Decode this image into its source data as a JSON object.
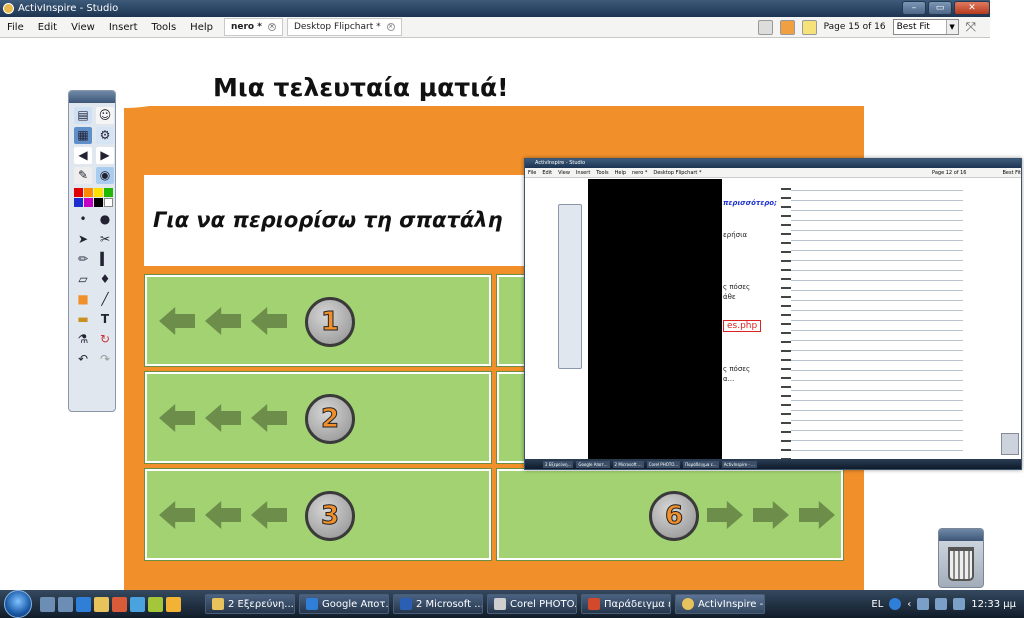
{
  "window": {
    "title": "ActivInspire - Studio"
  },
  "menu": {
    "items": [
      "File",
      "Edit",
      "View",
      "Insert",
      "Tools",
      "Help"
    ],
    "tabs": [
      {
        "label": "nero *",
        "active": true
      },
      {
        "label": "Desktop Flipchart *",
        "active": false
      }
    ],
    "page_indicator": "Page 15 of 16",
    "zoom": "Best Fit"
  },
  "flipchart": {
    "title": "Μια τελευταία ματιά!",
    "question": "Για να περιορίσω τη σπατάλη",
    "boxes": [
      {
        "number": "1",
        "arrow_direction": "left"
      },
      {
        "number": "2",
        "arrow_direction": "left"
      },
      {
        "number": "3",
        "arrow_direction": "left"
      },
      {
        "number": "6",
        "arrow_direction": "right"
      }
    ],
    "colors": {
      "orange": "#f18f2b",
      "green": "#a2d271",
      "arrow": "#6c8e4a"
    }
  },
  "inset": {
    "title": "ActivInspire - Studio",
    "menu_items": [
      "File",
      "Edit",
      "View",
      "Insert",
      "Tools",
      "Help"
    ],
    "tabs": [
      "nero *",
      "Desktop Flipchart *"
    ],
    "page_indicator": "Page 12 of 16",
    "zoom": "Best Fit",
    "notes": [
      {
        "text": "περισσότερο;",
        "style": "blue"
      },
      {
        "text": "ερήσια",
        "style": "plain"
      },
      {
        "text": "ς πόσες",
        "style": "plain"
      },
      {
        "text": "άθε",
        "style": "plain"
      },
      {
        "text": "es.php",
        "style": "red"
      },
      {
        "text": "ς πόσες",
        "style": "plain"
      },
      {
        "text": "α...",
        "style": "plain"
      }
    ]
  },
  "taskbar": {
    "buttons": [
      {
        "label": "2 Εξερεύνη...",
        "active": false
      },
      {
        "label": "Google Αποτ...",
        "active": false
      },
      {
        "label": "2 Microsoft ...",
        "active": false
      },
      {
        "label": "Corel PHOTO...",
        "active": false
      },
      {
        "label": "Παράδειγμα ε...",
        "active": false
      },
      {
        "label": "ActivInspire - ...",
        "active": true
      }
    ],
    "language": "EL",
    "clock": "12:33 μμ"
  }
}
